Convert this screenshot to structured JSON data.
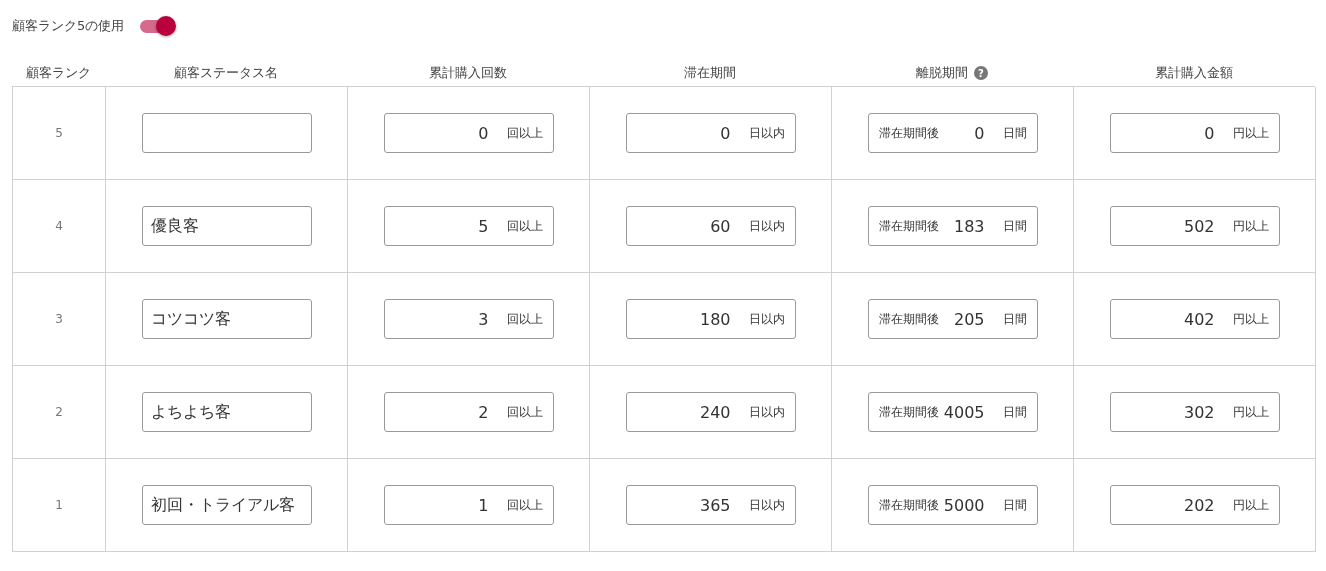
{
  "toggle": {
    "label": "顧客ランク5の使用",
    "on": true
  },
  "columns": [
    {
      "label": "顧客ランク"
    },
    {
      "label": "顧客ステータス名"
    },
    {
      "label": "累計購入回数"
    },
    {
      "label": "滞在期間"
    },
    {
      "label": "離脱期間",
      "help": "?"
    },
    {
      "label": "累計購入金額"
    }
  ],
  "rows": [
    {
      "rank": "5",
      "cells": [
        {
          "kind": "text"
        },
        {
          "kind": "number",
          "value": "0",
          "unit": "回以上"
        },
        {
          "kind": "number",
          "value": "0",
          "unit": "日以内"
        },
        {
          "kind": "prefixed",
          "prefix": "滞在期間後",
          "value": "0",
          "unit": "日間"
        },
        {
          "kind": "number",
          "value": "0",
          "unit": "円以上"
        }
      ]
    },
    {
      "rank": "4",
      "cells": [
        {
          "kind": "text",
          "value": "優良客"
        },
        {
          "kind": "number",
          "value": "5",
          "unit": "回以上"
        },
        {
          "kind": "number",
          "value": "60",
          "unit": "日以内"
        },
        {
          "kind": "prefixed",
          "prefix": "滞在期間後",
          "value": "183",
          "unit": "日間"
        },
        {
          "kind": "number",
          "value": "502",
          "unit": "円以上"
        }
      ]
    },
    {
      "rank": "3",
      "cells": [
        {
          "kind": "text",
          "value": "コツコツ客"
        },
        {
          "kind": "number",
          "value": "3",
          "unit": "回以上"
        },
        {
          "kind": "number",
          "value": "180",
          "unit": "日以内"
        },
        {
          "kind": "prefixed",
          "prefix": "滞在期間後",
          "value": "205",
          "unit": "日間"
        },
        {
          "kind": "number",
          "value": "402",
          "unit": "円以上"
        }
      ]
    },
    {
      "rank": "2",
      "cells": [
        {
          "kind": "text",
          "value": "よちよち客"
        },
        {
          "kind": "number",
          "value": "2",
          "unit": "回以上"
        },
        {
          "kind": "number",
          "value": "240",
          "unit": "日以内"
        },
        {
          "kind": "prefixed",
          "prefix": "滞在期間後",
          "value": "4005",
          "unit": "日間"
        },
        {
          "kind": "number",
          "value": "302",
          "unit": "円以上"
        }
      ]
    },
    {
      "rank": "1",
      "cells": [
        {
          "kind": "text",
          "value": "初回・トライアル客"
        },
        {
          "kind": "number",
          "value": "1",
          "unit": "回以上"
        },
        {
          "kind": "number",
          "value": "365",
          "unit": "日以内"
        },
        {
          "kind": "prefixed",
          "prefix": "滞在期間後",
          "value": "5000",
          "unit": "日間"
        },
        {
          "kind": "number",
          "value": "202",
          "unit": "円以上"
        }
      ]
    }
  ]
}
